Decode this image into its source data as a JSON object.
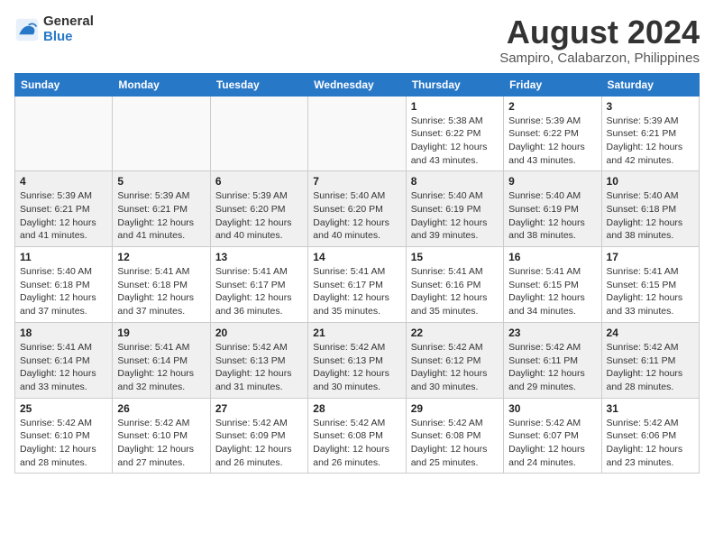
{
  "logo": {
    "line1": "General",
    "line2": "Blue"
  },
  "title": {
    "month_year": "August 2024",
    "location": "Sampiro, Calabarzon, Philippines"
  },
  "weekdays": [
    "Sunday",
    "Monday",
    "Tuesday",
    "Wednesday",
    "Thursday",
    "Friday",
    "Saturday"
  ],
  "weeks": [
    [
      {
        "day": "",
        "info": ""
      },
      {
        "day": "",
        "info": ""
      },
      {
        "day": "",
        "info": ""
      },
      {
        "day": "",
        "info": ""
      },
      {
        "day": "1",
        "info": "Sunrise: 5:38 AM\nSunset: 6:22 PM\nDaylight: 12 hours\nand 43 minutes."
      },
      {
        "day": "2",
        "info": "Sunrise: 5:39 AM\nSunset: 6:22 PM\nDaylight: 12 hours\nand 43 minutes."
      },
      {
        "day": "3",
        "info": "Sunrise: 5:39 AM\nSunset: 6:21 PM\nDaylight: 12 hours\nand 42 minutes."
      }
    ],
    [
      {
        "day": "4",
        "info": "Sunrise: 5:39 AM\nSunset: 6:21 PM\nDaylight: 12 hours\nand 41 minutes."
      },
      {
        "day": "5",
        "info": "Sunrise: 5:39 AM\nSunset: 6:21 PM\nDaylight: 12 hours\nand 41 minutes."
      },
      {
        "day": "6",
        "info": "Sunrise: 5:39 AM\nSunset: 6:20 PM\nDaylight: 12 hours\nand 40 minutes."
      },
      {
        "day": "7",
        "info": "Sunrise: 5:40 AM\nSunset: 6:20 PM\nDaylight: 12 hours\nand 40 minutes."
      },
      {
        "day": "8",
        "info": "Sunrise: 5:40 AM\nSunset: 6:19 PM\nDaylight: 12 hours\nand 39 minutes."
      },
      {
        "day": "9",
        "info": "Sunrise: 5:40 AM\nSunset: 6:19 PM\nDaylight: 12 hours\nand 38 minutes."
      },
      {
        "day": "10",
        "info": "Sunrise: 5:40 AM\nSunset: 6:18 PM\nDaylight: 12 hours\nand 38 minutes."
      }
    ],
    [
      {
        "day": "11",
        "info": "Sunrise: 5:40 AM\nSunset: 6:18 PM\nDaylight: 12 hours\nand 37 minutes."
      },
      {
        "day": "12",
        "info": "Sunrise: 5:41 AM\nSunset: 6:18 PM\nDaylight: 12 hours\nand 37 minutes."
      },
      {
        "day": "13",
        "info": "Sunrise: 5:41 AM\nSunset: 6:17 PM\nDaylight: 12 hours\nand 36 minutes."
      },
      {
        "day": "14",
        "info": "Sunrise: 5:41 AM\nSunset: 6:17 PM\nDaylight: 12 hours\nand 35 minutes."
      },
      {
        "day": "15",
        "info": "Sunrise: 5:41 AM\nSunset: 6:16 PM\nDaylight: 12 hours\nand 35 minutes."
      },
      {
        "day": "16",
        "info": "Sunrise: 5:41 AM\nSunset: 6:15 PM\nDaylight: 12 hours\nand 34 minutes."
      },
      {
        "day": "17",
        "info": "Sunrise: 5:41 AM\nSunset: 6:15 PM\nDaylight: 12 hours\nand 33 minutes."
      }
    ],
    [
      {
        "day": "18",
        "info": "Sunrise: 5:41 AM\nSunset: 6:14 PM\nDaylight: 12 hours\nand 33 minutes."
      },
      {
        "day": "19",
        "info": "Sunrise: 5:41 AM\nSunset: 6:14 PM\nDaylight: 12 hours\nand 32 minutes."
      },
      {
        "day": "20",
        "info": "Sunrise: 5:42 AM\nSunset: 6:13 PM\nDaylight: 12 hours\nand 31 minutes."
      },
      {
        "day": "21",
        "info": "Sunrise: 5:42 AM\nSunset: 6:13 PM\nDaylight: 12 hours\nand 30 minutes."
      },
      {
        "day": "22",
        "info": "Sunrise: 5:42 AM\nSunset: 6:12 PM\nDaylight: 12 hours\nand 30 minutes."
      },
      {
        "day": "23",
        "info": "Sunrise: 5:42 AM\nSunset: 6:11 PM\nDaylight: 12 hours\nand 29 minutes."
      },
      {
        "day": "24",
        "info": "Sunrise: 5:42 AM\nSunset: 6:11 PM\nDaylight: 12 hours\nand 28 minutes."
      }
    ],
    [
      {
        "day": "25",
        "info": "Sunrise: 5:42 AM\nSunset: 6:10 PM\nDaylight: 12 hours\nand 28 minutes."
      },
      {
        "day": "26",
        "info": "Sunrise: 5:42 AM\nSunset: 6:10 PM\nDaylight: 12 hours\nand 27 minutes."
      },
      {
        "day": "27",
        "info": "Sunrise: 5:42 AM\nSunset: 6:09 PM\nDaylight: 12 hours\nand 26 minutes."
      },
      {
        "day": "28",
        "info": "Sunrise: 5:42 AM\nSunset: 6:08 PM\nDaylight: 12 hours\nand 26 minutes."
      },
      {
        "day": "29",
        "info": "Sunrise: 5:42 AM\nSunset: 6:08 PM\nDaylight: 12 hours\nand 25 minutes."
      },
      {
        "day": "30",
        "info": "Sunrise: 5:42 AM\nSunset: 6:07 PM\nDaylight: 12 hours\nand 24 minutes."
      },
      {
        "day": "31",
        "info": "Sunrise: 5:42 AM\nSunset: 6:06 PM\nDaylight: 12 hours\nand 23 minutes."
      }
    ]
  ]
}
